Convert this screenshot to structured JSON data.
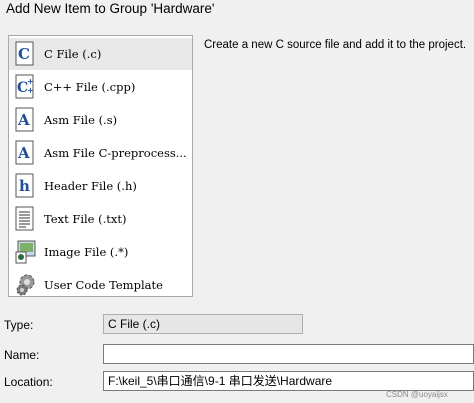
{
  "dialog": {
    "title": "Add New Item to Group 'Hardware'"
  },
  "item_list": {
    "selected_index": 0,
    "items": [
      {
        "label": "C File (.c)",
        "icon": "c-file-icon"
      },
      {
        "label": "C++ File (.cpp)",
        "icon": "cpp-file-icon"
      },
      {
        "label": "Asm File (.s)",
        "icon": "asm-file-icon"
      },
      {
        "label": "Asm File C-preprocess...",
        "icon": "asm-preprocess-file-icon"
      },
      {
        "label": "Header File (.h)",
        "icon": "header-file-icon"
      },
      {
        "label": "Text File (.txt)",
        "icon": "text-file-icon"
      },
      {
        "label": "Image File (.*)",
        "icon": "image-file-icon"
      },
      {
        "label": "User Code Template",
        "icon": "user-code-template-icon"
      }
    ]
  },
  "description": "Create a new C source file and add it to the project.",
  "form": {
    "type_label": "Type:",
    "type_value": "C File (.c)",
    "name_label": "Name:",
    "name_value": "",
    "location_label": "Location:",
    "location_value": "F:\\keil_5\\串口通信\\9-1 串口发送\\Hardware"
  },
  "watermark": "CSDN @uoyaijsx",
  "colors": {
    "selected_row": "#e8e8e8",
    "icon_accent": "#1f4e9c",
    "dialog_bg": "#f0f0f0"
  }
}
